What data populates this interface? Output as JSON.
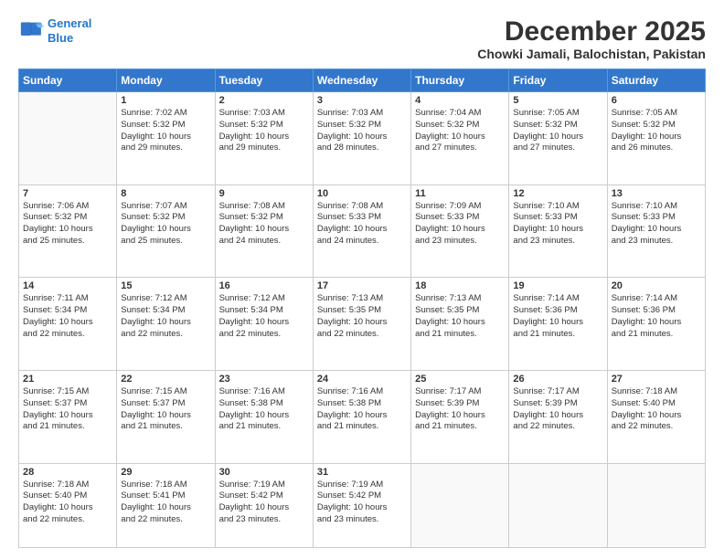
{
  "logo": {
    "line1": "General",
    "line2": "Blue"
  },
  "header": {
    "month": "December 2025",
    "location": "Chowki Jamali, Balochistan, Pakistan"
  },
  "weekdays": [
    "Sunday",
    "Monday",
    "Tuesday",
    "Wednesday",
    "Thursday",
    "Friday",
    "Saturday"
  ],
  "weeks": [
    [
      {
        "day": "",
        "info": ""
      },
      {
        "day": "1",
        "info": "Sunrise: 7:02 AM\nSunset: 5:32 PM\nDaylight: 10 hours\nand 29 minutes."
      },
      {
        "day": "2",
        "info": "Sunrise: 7:03 AM\nSunset: 5:32 PM\nDaylight: 10 hours\nand 29 minutes."
      },
      {
        "day": "3",
        "info": "Sunrise: 7:03 AM\nSunset: 5:32 PM\nDaylight: 10 hours\nand 28 minutes."
      },
      {
        "day": "4",
        "info": "Sunrise: 7:04 AM\nSunset: 5:32 PM\nDaylight: 10 hours\nand 27 minutes."
      },
      {
        "day": "5",
        "info": "Sunrise: 7:05 AM\nSunset: 5:32 PM\nDaylight: 10 hours\nand 27 minutes."
      },
      {
        "day": "6",
        "info": "Sunrise: 7:05 AM\nSunset: 5:32 PM\nDaylight: 10 hours\nand 26 minutes."
      }
    ],
    [
      {
        "day": "7",
        "info": "Sunrise: 7:06 AM\nSunset: 5:32 PM\nDaylight: 10 hours\nand 25 minutes."
      },
      {
        "day": "8",
        "info": "Sunrise: 7:07 AM\nSunset: 5:32 PM\nDaylight: 10 hours\nand 25 minutes."
      },
      {
        "day": "9",
        "info": "Sunrise: 7:08 AM\nSunset: 5:32 PM\nDaylight: 10 hours\nand 24 minutes."
      },
      {
        "day": "10",
        "info": "Sunrise: 7:08 AM\nSunset: 5:33 PM\nDaylight: 10 hours\nand 24 minutes."
      },
      {
        "day": "11",
        "info": "Sunrise: 7:09 AM\nSunset: 5:33 PM\nDaylight: 10 hours\nand 23 minutes."
      },
      {
        "day": "12",
        "info": "Sunrise: 7:10 AM\nSunset: 5:33 PM\nDaylight: 10 hours\nand 23 minutes."
      },
      {
        "day": "13",
        "info": "Sunrise: 7:10 AM\nSunset: 5:33 PM\nDaylight: 10 hours\nand 23 minutes."
      }
    ],
    [
      {
        "day": "14",
        "info": "Sunrise: 7:11 AM\nSunset: 5:34 PM\nDaylight: 10 hours\nand 22 minutes."
      },
      {
        "day": "15",
        "info": "Sunrise: 7:12 AM\nSunset: 5:34 PM\nDaylight: 10 hours\nand 22 minutes."
      },
      {
        "day": "16",
        "info": "Sunrise: 7:12 AM\nSunset: 5:34 PM\nDaylight: 10 hours\nand 22 minutes."
      },
      {
        "day": "17",
        "info": "Sunrise: 7:13 AM\nSunset: 5:35 PM\nDaylight: 10 hours\nand 22 minutes."
      },
      {
        "day": "18",
        "info": "Sunrise: 7:13 AM\nSunset: 5:35 PM\nDaylight: 10 hours\nand 21 minutes."
      },
      {
        "day": "19",
        "info": "Sunrise: 7:14 AM\nSunset: 5:36 PM\nDaylight: 10 hours\nand 21 minutes."
      },
      {
        "day": "20",
        "info": "Sunrise: 7:14 AM\nSunset: 5:36 PM\nDaylight: 10 hours\nand 21 minutes."
      }
    ],
    [
      {
        "day": "21",
        "info": "Sunrise: 7:15 AM\nSunset: 5:37 PM\nDaylight: 10 hours\nand 21 minutes."
      },
      {
        "day": "22",
        "info": "Sunrise: 7:15 AM\nSunset: 5:37 PM\nDaylight: 10 hours\nand 21 minutes."
      },
      {
        "day": "23",
        "info": "Sunrise: 7:16 AM\nSunset: 5:38 PM\nDaylight: 10 hours\nand 21 minutes."
      },
      {
        "day": "24",
        "info": "Sunrise: 7:16 AM\nSunset: 5:38 PM\nDaylight: 10 hours\nand 21 minutes."
      },
      {
        "day": "25",
        "info": "Sunrise: 7:17 AM\nSunset: 5:39 PM\nDaylight: 10 hours\nand 21 minutes."
      },
      {
        "day": "26",
        "info": "Sunrise: 7:17 AM\nSunset: 5:39 PM\nDaylight: 10 hours\nand 22 minutes."
      },
      {
        "day": "27",
        "info": "Sunrise: 7:18 AM\nSunset: 5:40 PM\nDaylight: 10 hours\nand 22 minutes."
      }
    ],
    [
      {
        "day": "28",
        "info": "Sunrise: 7:18 AM\nSunset: 5:40 PM\nDaylight: 10 hours\nand 22 minutes."
      },
      {
        "day": "29",
        "info": "Sunrise: 7:18 AM\nSunset: 5:41 PM\nDaylight: 10 hours\nand 22 minutes."
      },
      {
        "day": "30",
        "info": "Sunrise: 7:19 AM\nSunset: 5:42 PM\nDaylight: 10 hours\nand 23 minutes."
      },
      {
        "day": "31",
        "info": "Sunrise: 7:19 AM\nSunset: 5:42 PM\nDaylight: 10 hours\nand 23 minutes."
      },
      {
        "day": "",
        "info": ""
      },
      {
        "day": "",
        "info": ""
      },
      {
        "day": "",
        "info": ""
      }
    ]
  ]
}
